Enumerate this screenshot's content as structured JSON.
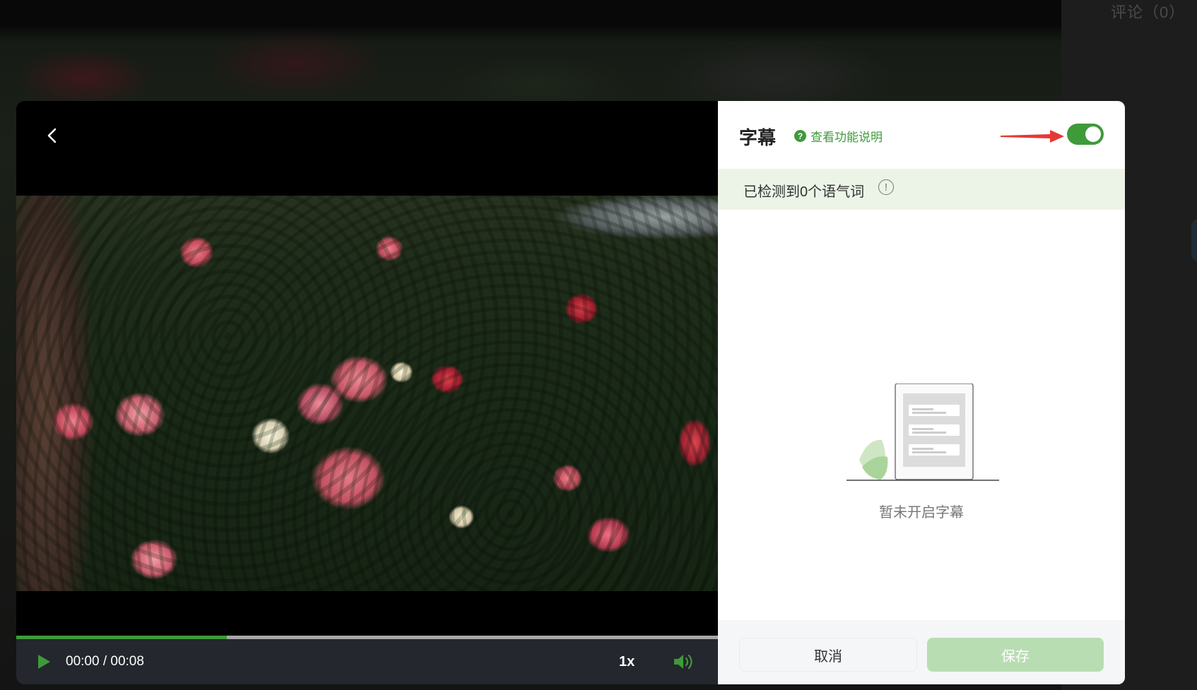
{
  "background": {
    "comments_label": "评论（0）"
  },
  "player": {
    "time": "00:00 / 00:08",
    "speed": "1x",
    "progress": 0.3,
    "accent_color": "#3f9a3a"
  },
  "subtitle_panel": {
    "title": "字幕",
    "help_link": "查看功能说明",
    "toggle_on": true,
    "detect_text": "已检测到0个语气词",
    "info_icon": "!",
    "empty_text": "暂未开启字幕",
    "cancel_label": "取消",
    "save_label": "保存"
  },
  "colors": {
    "accent": "#3f9a3a",
    "save_disabled": "#b8ddb2",
    "detect_bg": "#ebf4e6",
    "arrow": "#e53935"
  },
  "icons": {
    "back": "chevron-left-icon",
    "play": "play-icon",
    "volume": "volume-icon",
    "help": "question-circle-icon",
    "info": "exclamation-circle-icon",
    "pointer": "red-arrow-icon"
  }
}
